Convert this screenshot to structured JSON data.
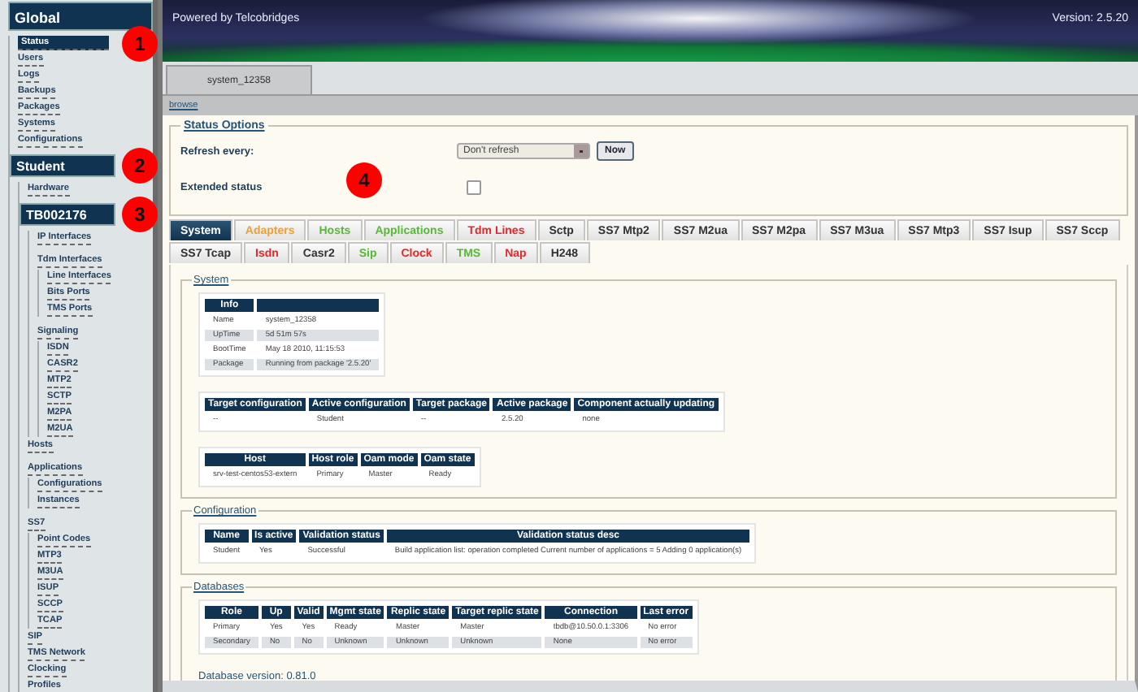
{
  "header": {
    "brand": "Powered by Telcobridges",
    "version": "Version: 2.5.20"
  },
  "sidebar": {
    "items": [
      {
        "label": "Global",
        "kind": "header",
        "selected": false,
        "children": [
          {
            "label": "Status",
            "kind": "link",
            "selected": true
          },
          {
            "label": "Users",
            "kind": "link",
            "selected": false
          },
          {
            "label": "Logs",
            "kind": "link",
            "selected": false
          },
          {
            "label": "Backups",
            "kind": "link",
            "selected": false
          },
          {
            "label": "Packages",
            "kind": "link",
            "selected": false
          },
          {
            "label": "Systems",
            "kind": "link",
            "selected": false
          },
          {
            "label": "Configurations",
            "kind": "link",
            "selected": false
          },
          {
            "label": "Student",
            "kind": "header",
            "selected": false,
            "children": [
              {
                "label": "Hardware",
                "kind": "link",
                "selected": false
              },
              {
                "label": "TB002176",
                "kind": "header",
                "selected": false,
                "children": [
                  {
                    "label": "IP Interfaces",
                    "kind": "link",
                    "selected": false
                  },
                  {
                    "label": "Tdm Interfaces",
                    "kind": "link",
                    "selected": false,
                    "children": [
                      {
                        "label": "Line Interfaces",
                        "kind": "link",
                        "selected": false
                      },
                      {
                        "label": "Bits Ports",
                        "kind": "link",
                        "selected": false
                      },
                      {
                        "label": "TMS Ports",
                        "kind": "link",
                        "selected": false
                      }
                    ]
                  },
                  {
                    "label": "Signaling",
                    "kind": "link",
                    "selected": false,
                    "children": [
                      {
                        "label": "ISDN",
                        "kind": "link",
                        "selected": false
                      },
                      {
                        "label": "CASR2",
                        "kind": "link",
                        "selected": false
                      },
                      {
                        "label": "MTP2",
                        "kind": "link",
                        "selected": false
                      },
                      {
                        "label": "SCTP",
                        "kind": "link",
                        "selected": false
                      },
                      {
                        "label": "M2PA",
                        "kind": "link",
                        "selected": false
                      },
                      {
                        "label": "M2UA",
                        "kind": "link",
                        "selected": false
                      }
                    ]
                  }
                ]
              },
              {
                "label": "Hosts",
                "kind": "link",
                "selected": false
              },
              {
                "label": "Applications",
                "kind": "link",
                "selected": false,
                "children": [
                  {
                    "label": "Configurations",
                    "kind": "link",
                    "selected": false
                  },
                  {
                    "label": "Instances",
                    "kind": "link",
                    "selected": false
                  }
                ]
              },
              {
                "label": "SS7",
                "kind": "link",
                "selected": false,
                "children": [
                  {
                    "label": "Point Codes",
                    "kind": "link",
                    "selected": false
                  },
                  {
                    "label": "MTP3",
                    "kind": "link",
                    "selected": false
                  },
                  {
                    "label": "M3UA",
                    "kind": "link",
                    "selected": false
                  },
                  {
                    "label": "ISUP",
                    "kind": "link",
                    "selected": false
                  },
                  {
                    "label": "SCCP",
                    "kind": "link",
                    "selected": false
                  },
                  {
                    "label": "TCAP",
                    "kind": "link",
                    "selected": false
                  }
                ]
              },
              {
                "label": "SIP",
                "kind": "link",
                "selected": false
              },
              {
                "label": "TMS Network",
                "kind": "link",
                "selected": false
              },
              {
                "label": "Clocking",
                "kind": "link",
                "selected": false
              },
              {
                "label": "Profiles",
                "kind": "link",
                "selected": false
              }
            ]
          }
        ]
      }
    ]
  },
  "page_tabs": [
    {
      "label": "system_12358",
      "selected": true
    }
  ],
  "breadcrumb": "browse",
  "status_options": {
    "legend": "Status Options",
    "refresh_label": "Refresh every:",
    "refresh_value": "Don't refresh",
    "now_button": "Now",
    "extended_label": "Extended status",
    "extended_checked": false
  },
  "tabs": [
    {
      "label": "System",
      "selected": true
    },
    {
      "label": "Adapters",
      "selected": false,
      "color": "#f0a030"
    },
    {
      "label": "Hosts",
      "selected": false,
      "color": "#55bb33"
    },
    {
      "label": "Applications",
      "selected": false,
      "color": "#55bb33"
    },
    {
      "label": "Tdm Lines",
      "selected": false,
      "color": "#e8262a"
    },
    {
      "label": "Sctp",
      "selected": false,
      "color": "#333333"
    },
    {
      "label": "SS7 Mtp2",
      "selected": false,
      "color": "#333333"
    },
    {
      "label": "SS7 M2ua",
      "selected": false,
      "color": "#333333"
    },
    {
      "label": "SS7 M2pa",
      "selected": false,
      "color": "#333333"
    },
    {
      "label": "SS7 M3ua",
      "selected": false,
      "color": "#333333"
    },
    {
      "label": "SS7 Mtp3",
      "selected": false,
      "color": "#333333"
    },
    {
      "label": "SS7 Isup",
      "selected": false,
      "color": "#333333"
    },
    {
      "label": "SS7 Sccp",
      "selected": false,
      "color": "#333333"
    },
    {
      "label": "SS7 Tcap",
      "selected": false,
      "color": "#333333"
    },
    {
      "label": "Isdn",
      "selected": false,
      "color": "#e8262a"
    },
    {
      "label": "Casr2",
      "selected": false,
      "color": "#333333"
    },
    {
      "label": "Sip",
      "selected": false,
      "color": "#55bb33"
    },
    {
      "label": "Clock",
      "selected": false,
      "color": "#e8262a"
    },
    {
      "label": "TMS",
      "selected": false,
      "color": "#55bb33"
    },
    {
      "label": "Nap",
      "selected": false,
      "color": "#e8262a"
    },
    {
      "label": "H248",
      "selected": false,
      "color": "#333333"
    }
  ],
  "sections": [
    {
      "legend": "System",
      "tables": [
        {
          "columns": [
            "Info"
          ],
          "rows": [
            [
              "Name",
              "system_12358"
            ],
            [
              "UpTime",
              "5d 51m 57s"
            ],
            [
              "BootTime",
              "May 18 2010, 11:15:53"
            ],
            [
              "Package",
              "Running from package '2.5.20'"
            ]
          ]
        },
        {
          "columns": [
            "Target configuration",
            "Active configuration",
            "Target package",
            "Active package",
            "Component actually updating"
          ],
          "rows": [
            [
              "--",
              "Student",
              "--",
              "2.5.20",
              "none"
            ]
          ]
        },
        {
          "columns": [
            "Host",
            "Host role",
            "Oam mode",
            "Oam state"
          ],
          "rows": [
            [
              "srv-test-centos53-extern",
              "Primary",
              "Master",
              "Ready"
            ]
          ]
        }
      ]
    },
    {
      "legend": "Configuration",
      "tables": [
        {
          "columns": [
            "Name",
            "Is active",
            "Validation status",
            "Validation status desc"
          ],
          "rows": [
            [
              "Student",
              "Yes",
              "Successful",
              "Build application list: operation completed Current number of applications = 5 Adding 0 application(s)"
            ]
          ]
        }
      ]
    },
    {
      "legend": "Databases",
      "tables": [
        {
          "columns": [
            "Role",
            "Up",
            "Valid",
            "Mgmt state",
            "Replic state",
            "Target replic state",
            "Connection",
            "Last error"
          ],
          "rows": [
            [
              "Primary",
              "Yes",
              "Yes",
              "Ready",
              "Master",
              "Master",
              "tbdb@10.50.0.1:3306",
              "No error"
            ],
            [
              "Secondary",
              "No",
              "No",
              "Unknown",
              "Unknown",
              "Unknown",
              "None",
              "No error"
            ]
          ]
        }
      ],
      "note": "Database version: 0.81.0"
    }
  ],
  "markers": [
    {
      "label": "1"
    },
    {
      "label": "2"
    },
    {
      "label": "3"
    },
    {
      "label": "4"
    }
  ]
}
